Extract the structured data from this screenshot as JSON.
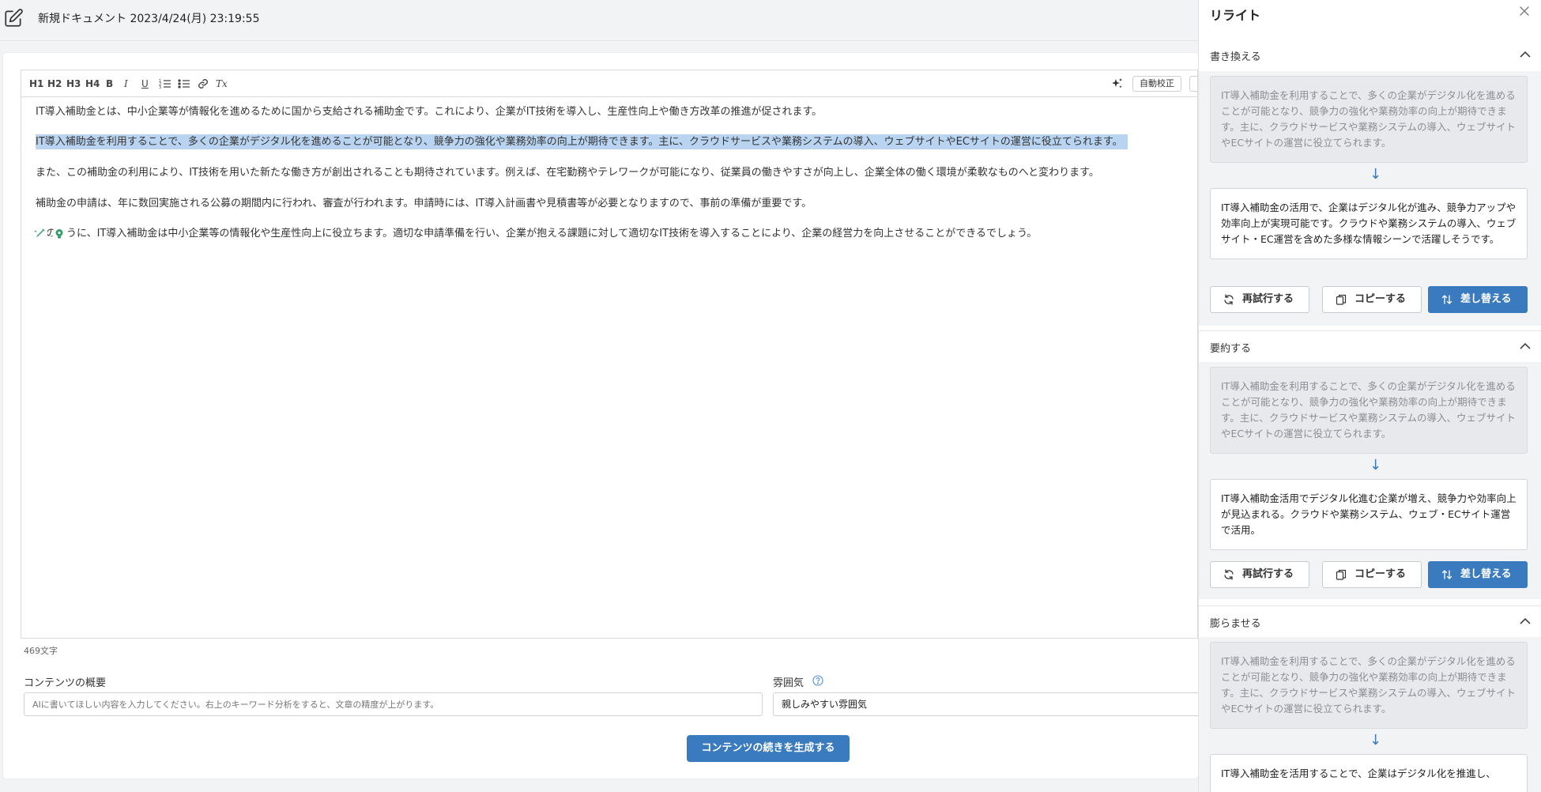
{
  "document": {
    "title": "新規ドキュメント 2023/4/24(月) 23:19:55"
  },
  "toolbar": {
    "h1": "H1",
    "h2": "H2",
    "h3": "H3",
    "h4": "H4",
    "bold": "B",
    "italic": "I",
    "underline": "U",
    "clear": "Tx",
    "autofix_label": "自動校正"
  },
  "editor": {
    "paragraphs": [
      "IT導入補助金とは、中小企業等が情報化を進めるために国から支給される補助金です。これにより、企業がIT技術を導入し、生産性向上や働き方改革の推進が促されます。",
      "IT導入補助金を利用することで、多くの企業がデジタル化を進めることが可能となり、競争力の強化や業務効率の向上が期待できます。主に、クラウドサービスや業務システムの導入、ウェブサイトやECサイトの運営に役立てられます。",
      "また、この補助金の利用により、IT技術を用いた新たな働き方が創出されることも期待されています。例えば、在宅勤務やテレワークが可能になり、従業員の働きやすさが向上し、企業全体の働く環境が柔軟なものへと変わります。",
      "補助金の申請は、年に数回実施される公募の期間内に行われ、審査が行われます。申請時には、IT導入計画書や見積書等が必要となりますので、事前の準備が重要です。",
      "このように、IT導入補助金は中小企業等の情報化や生産性向上に役立ちます。適切な申請準備を行い、企業が抱える課題に対して適切なIT技術を導入することにより、企業の経営力を向上させることができるでしょう。"
    ],
    "char_count": "469文字"
  },
  "form": {
    "summary_label": "コンテンツの概要",
    "summary_placeholder": "AIに書いてほしい内容を入力してください。右上のキーワード分析をすると、文章の精度が上がります。",
    "mood_label": "雰囲気",
    "mood_value": "親しみやすい雰囲気",
    "generate_button": "コンテンツの続きを生成する"
  },
  "panel": {
    "title": "リライト",
    "original_text": "IT導入補助金を利用することで、多くの企業がデジタル化を進めることが可能となり、競争力の強化や業務効率の向上が期待できます。主に、クラウドサービスや業務システムの導入、ウェブサイトやECサイトの運営に役立てられます。",
    "arrow": "↓",
    "sections": [
      {
        "label": "書き換える",
        "result": "IT導入補助金の活用で、企業はデジタル化が進み、競争力アップや効率向上が実現可能です。クラウドや業務システムの導入、ウェブサイト・EC運営を含めた多様な情報シーンで活躍しそうです。"
      },
      {
        "label": "要約する",
        "result": "IT導入補助金活用でデジタル化進む企業が増え、競争力や効率向上が見込まれる。クラウドや業務システム、ウェブ・ECサイト運営で活用。"
      },
      {
        "label": "膨らませる",
        "result": "IT導入補助金を活用することで、企業はデジタル化を推進し、"
      }
    ],
    "retry_label": "再試行する",
    "copy_label": "コピーする",
    "replace_label": "差し替える"
  },
  "colors": {
    "accent": "#3a7bbf",
    "selection": "#b9d4f1",
    "panel_bg": "#f2f3f5"
  }
}
